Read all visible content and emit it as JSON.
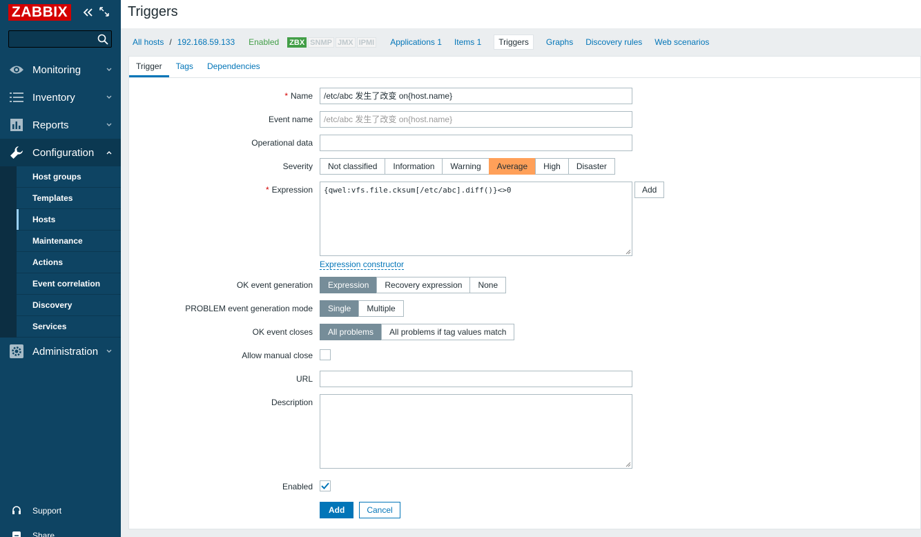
{
  "sidebar": {
    "logo": "ZABBIX",
    "menu": [
      {
        "label": "Monitoring",
        "icon": "eye-icon"
      },
      {
        "label": "Inventory",
        "icon": "list-icon"
      },
      {
        "label": "Reports",
        "icon": "bar-chart-icon"
      },
      {
        "label": "Configuration",
        "icon": "wrench-icon"
      },
      {
        "label": "Administration",
        "icon": "gear-icon"
      }
    ],
    "config_submenu": [
      "Host groups",
      "Templates",
      "Hosts",
      "Maintenance",
      "Actions",
      "Event correlation",
      "Discovery",
      "Services"
    ],
    "support": "Support",
    "share": "Share"
  },
  "header": {
    "title": "Triggers"
  },
  "nav": {
    "all_hosts": "All hosts",
    "separator": "/",
    "host": "192.168.59.133",
    "status": "Enabled",
    "badges": [
      "ZBX",
      "SNMP",
      "JMX",
      "IPMI"
    ],
    "tabs": [
      "Applications 1",
      "Items 1",
      "Triggers",
      "Graphs",
      "Discovery rules",
      "Web scenarios"
    ]
  },
  "form_tabs": [
    "Trigger",
    "Tags",
    "Dependencies"
  ],
  "form": {
    "name_label": "Name",
    "name_value": "/etc/abc 发生了改变 on{host.name}",
    "event_name_label": "Event name",
    "event_name_placeholder": "/etc/abc 发生了改变 on{host.name}",
    "operational_data_label": "Operational data",
    "operational_data_value": "",
    "severity_label": "Severity",
    "severity_options": [
      "Not classified",
      "Information",
      "Warning",
      "Average",
      "High",
      "Disaster"
    ],
    "severity_selected": "Average",
    "expression_label": "Expression",
    "expression_value": "{qwel:vfs.file.cksum[/etc/abc].diff()}<>0",
    "add_label": "Add",
    "expression_constructor": "Expression constructor",
    "ok_event_gen_label": "OK event generation",
    "ok_event_gen_options": [
      "Expression",
      "Recovery expression",
      "None"
    ],
    "problem_mode_label": "PROBLEM event generation mode",
    "problem_mode_options": [
      "Single",
      "Multiple"
    ],
    "ok_closes_label": "OK event closes",
    "ok_closes_options": [
      "All problems",
      "All problems if tag values match"
    ],
    "manual_close_label": "Allow manual close",
    "url_label": "URL",
    "url_value": "",
    "description_label": "Description",
    "description_value": "",
    "enabled_label": "Enabled",
    "submit_label": "Add",
    "cancel_label": "Cancel"
  },
  "colors": {
    "sidebar_bg": "#0e4463",
    "accent": "#0275b8",
    "logo_red": "#d40000",
    "severity_average": "#ffa059",
    "enabled_green": "#429e47"
  }
}
